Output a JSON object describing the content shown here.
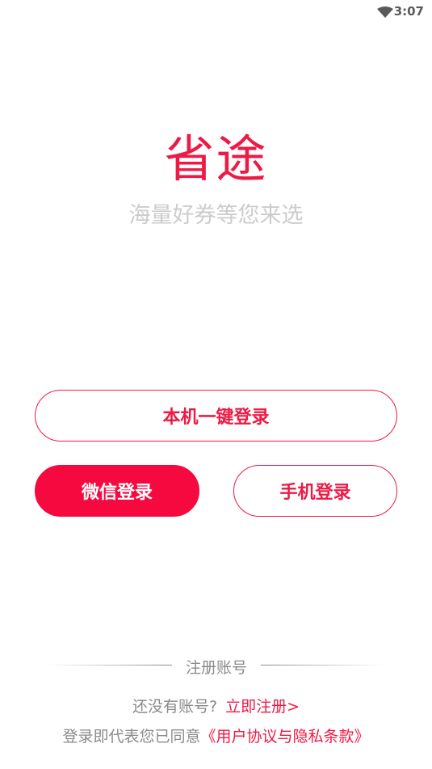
{
  "status_bar": {
    "time": "3:07",
    "wifi_icon": "wifi-icon"
  },
  "app": {
    "title": "省途",
    "subtitle": "海量好券等您来选"
  },
  "buttons": {
    "one_key_login": "本机一键登录",
    "wechat_login": "微信登录",
    "phone_login": "手机登录"
  },
  "register": {
    "divider_label": "注册账号",
    "no_account_text": "还没有账号?",
    "register_link": "立即注册>"
  },
  "agreement": {
    "prefix": "登录即代表您已同意",
    "link": "《用户协议与隐私条款》"
  },
  "colors": {
    "accent": "#ee1944",
    "button_fill": "#f5093f",
    "muted_text": "#8a8a8a",
    "subtitle": "#cccccc"
  }
}
